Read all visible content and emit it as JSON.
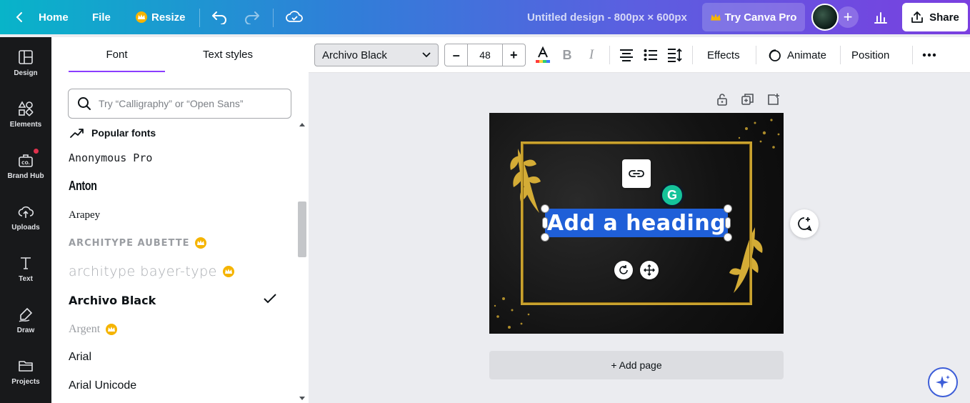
{
  "topbar": {
    "home_label": "Home",
    "file_label": "File",
    "resize_label": "Resize",
    "doc_title": "Untitled design - 800px × 600px",
    "try_pro_label": "Try Canva Pro",
    "share_label": "Share"
  },
  "rail": {
    "items": [
      {
        "label": "Design",
        "icon": "layout-icon"
      },
      {
        "label": "Elements",
        "icon": "shapes-icon"
      },
      {
        "label": "Brand Hub",
        "icon": "briefcase-icon"
      },
      {
        "label": "Uploads",
        "icon": "cloud-upload-icon"
      },
      {
        "label": "Text",
        "icon": "text-icon"
      },
      {
        "label": "Draw",
        "icon": "pen-icon"
      },
      {
        "label": "Projects",
        "icon": "folder-icon"
      }
    ]
  },
  "panel": {
    "tab_font": "Font",
    "tab_text_styles": "Text styles",
    "search_placeholder": "Try “Calligraphy” or “Open Sans”",
    "popular_label": "Popular fonts",
    "fonts": [
      {
        "name": "Anonymous Pro",
        "pro": false,
        "selected": false
      },
      {
        "name": "Anton",
        "pro": false,
        "selected": false
      },
      {
        "name": "Arapey",
        "pro": false,
        "selected": false
      },
      {
        "name": "ARCHITYPE AUBETTE",
        "pro": true,
        "selected": false
      },
      {
        "name": "architype bayer-type",
        "pro": true,
        "selected": false
      },
      {
        "name": "Archivo Black",
        "pro": false,
        "selected": true
      },
      {
        "name": "Argent",
        "pro": true,
        "selected": false
      },
      {
        "name": "Arial",
        "pro": false,
        "selected": false
      },
      {
        "name": "Arial Unicode",
        "pro": false,
        "selected": false
      }
    ]
  },
  "toolbar": {
    "font_family": "Archivo Black",
    "font_size": "48",
    "effects_label": "Effects",
    "animate_label": "Animate",
    "position_label": "Position"
  },
  "canvas": {
    "heading_text": "Add a heading",
    "add_page_label": "+ Add page"
  },
  "colors": {
    "accent": "#8b3dff",
    "selection": "#1f5fd8",
    "gold": "#c9a22f",
    "grammarly": "#15c39a"
  }
}
